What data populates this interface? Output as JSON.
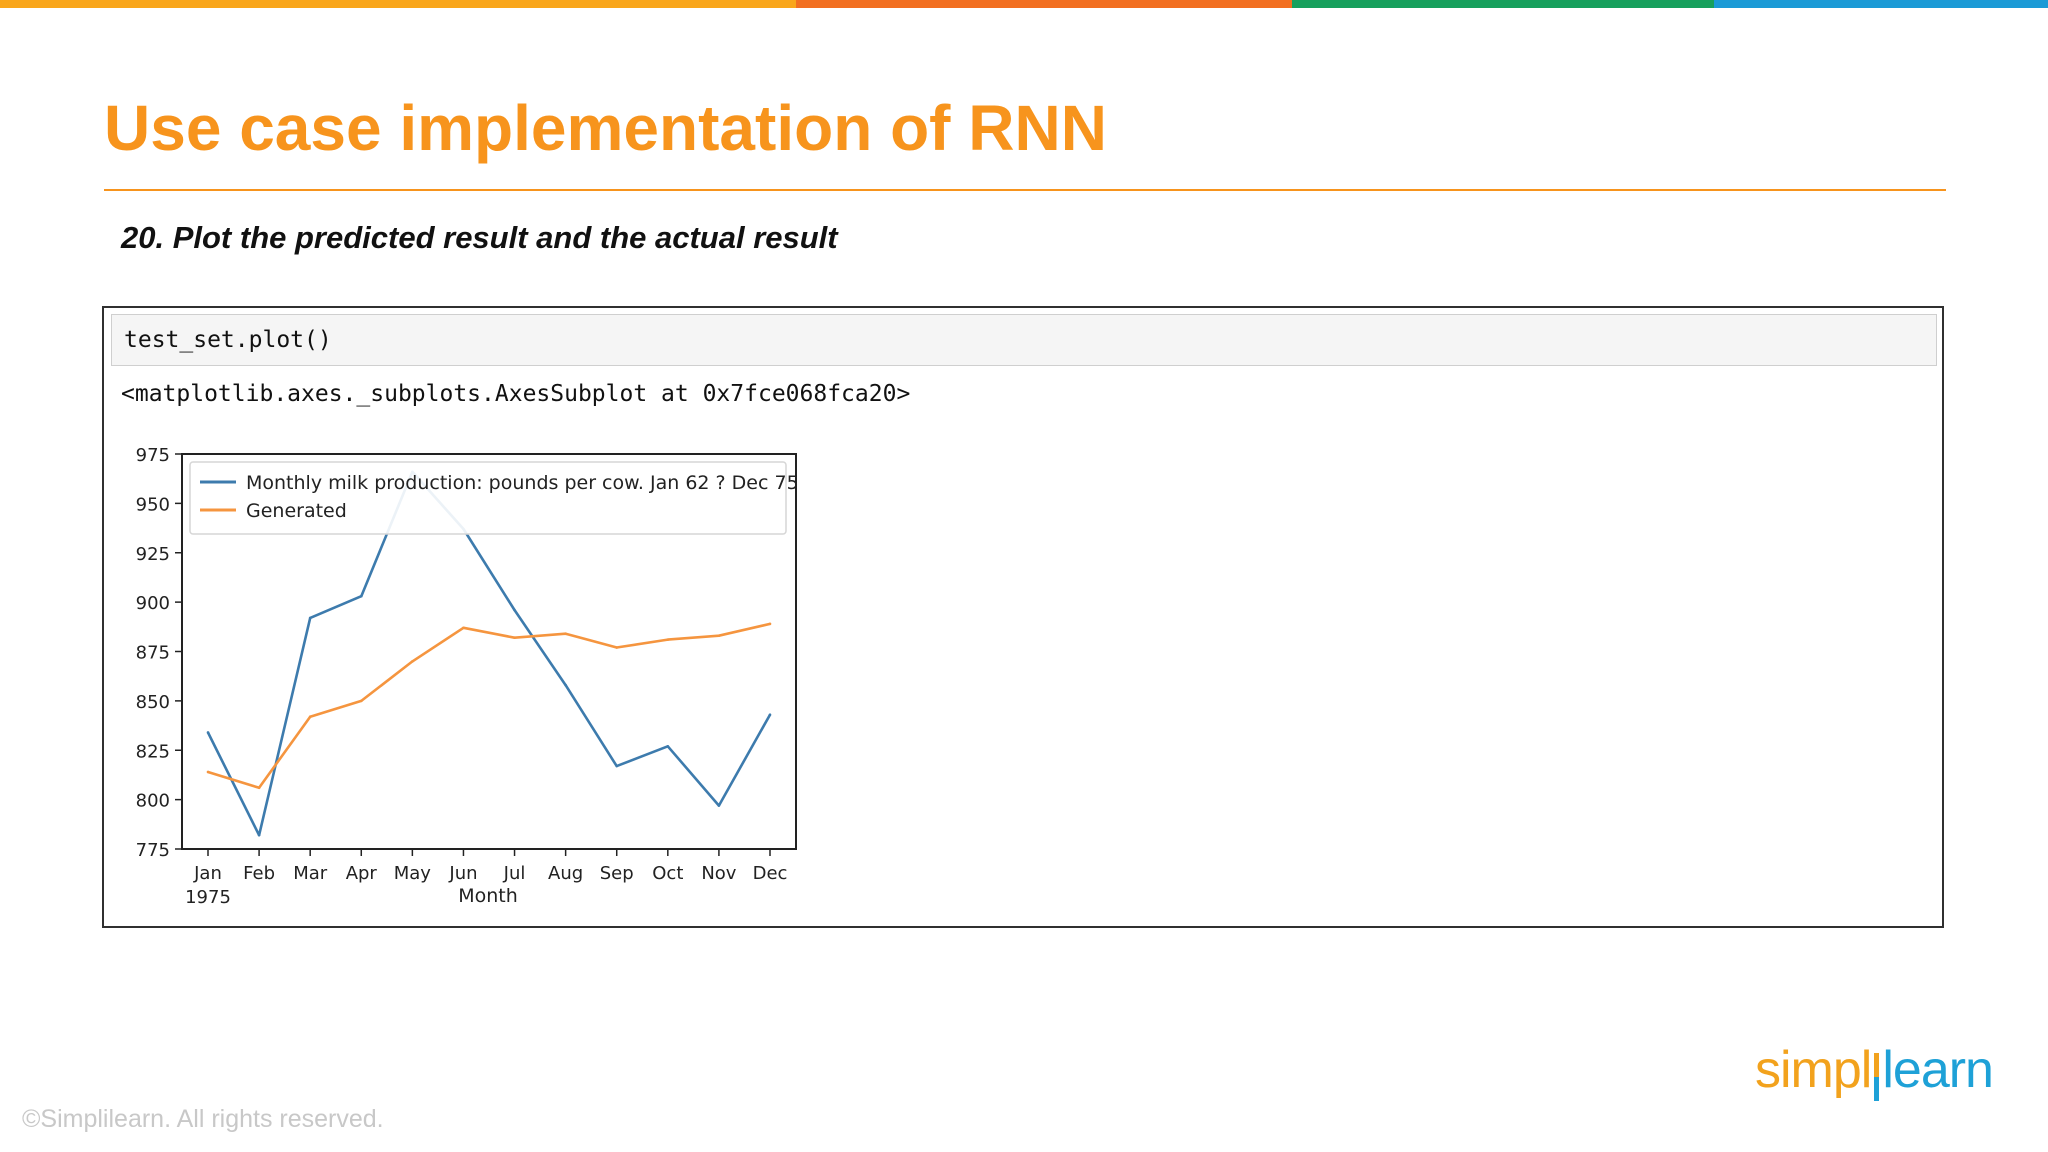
{
  "colors": {
    "accent": "#f7941d",
    "top_bar": [
      "#f9a61b",
      "#f26f21",
      "#17a05d",
      "#1b9ad6"
    ],
    "series": [
      "#3d7bad",
      "#f5953f"
    ]
  },
  "slide": {
    "title": "Use case implementation of RNN",
    "step": "20. Plot the predicted result and the actual result"
  },
  "notebook": {
    "input_code": "test_set.plot()",
    "output_text": "<matplotlib.axes._subplots.AxesSubplot at 0x7fce068fca20>"
  },
  "chart_data": {
    "type": "line",
    "title": "",
    "xlabel": "Month",
    "ylabel": "",
    "categories": [
      "Jan",
      "Feb",
      "Mar",
      "Apr",
      "May",
      "Jun",
      "Jul",
      "Aug",
      "Sep",
      "Oct",
      "Nov",
      "Dec"
    ],
    "x_year_label": "1975",
    "ylim": [
      775,
      975
    ],
    "yticks": [
      775,
      800,
      825,
      850,
      875,
      900,
      925,
      950,
      975
    ],
    "grid": false,
    "legend_position": "top-left",
    "series": [
      {
        "name": "Monthly milk production: pounds per cow. Jan 62 ? Dec 75",
        "color": "#3d7bad",
        "values": [
          834,
          782,
          892,
          903,
          966,
          937,
          896,
          858,
          817,
          827,
          797,
          843
        ]
      },
      {
        "name": "Generated",
        "color": "#f5953f",
        "values": [
          814,
          806,
          842,
          850,
          870,
          887,
          882,
          884,
          877,
          881,
          883,
          889
        ]
      }
    ]
  },
  "footer": {
    "copyright": "©Simplilearn. All rights reserved.",
    "logo_part1": "simpl",
    "logo_part2": "learn"
  }
}
